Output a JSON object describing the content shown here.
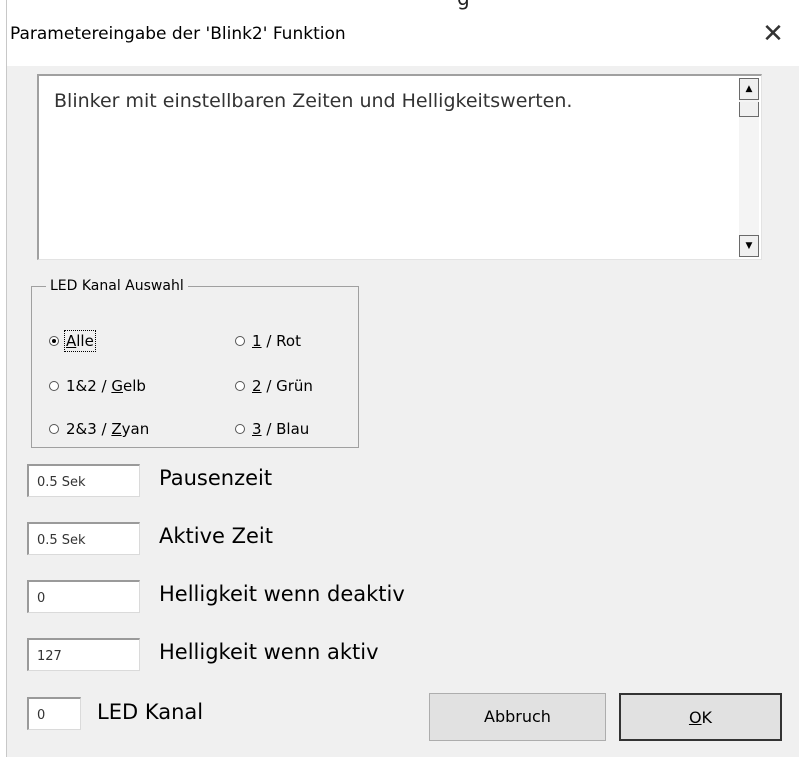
{
  "window": {
    "clipped_top_text": "g",
    "title": "Parametereingabe der 'Blink2' Funktion",
    "close_glyph": "✕"
  },
  "description": {
    "text": "Blinker mit einstellbaren Zeiten und Helligkeitswerten.",
    "scroll_up": "▲",
    "scroll_down": "▼"
  },
  "channel_group": {
    "legend": "LED Kanal Auswahl",
    "options": [
      {
        "pre": "",
        "accel": "A",
        "post": "lle",
        "selected": true
      },
      {
        "pre": "",
        "accel": "1",
        "post": " / Rot",
        "selected": false
      },
      {
        "pre": "1&2 / ",
        "accel": "G",
        "post": "elb",
        "selected": false
      },
      {
        "pre": "",
        "accel": "2",
        "post": " / Grün",
        "selected": false
      },
      {
        "pre": "2&3 / ",
        "accel": "Z",
        "post": "yan",
        "selected": false
      },
      {
        "pre": "",
        "accel": "3",
        "post": " / Blau",
        "selected": false
      }
    ]
  },
  "fields": {
    "pause": {
      "value": "0.5 Sek",
      "label": "Pausenzeit"
    },
    "active": {
      "value": "0.5 Sek",
      "label": "Aktive Zeit"
    },
    "bright_off": {
      "value": "0",
      "label": "Helligkeit wenn deaktiv"
    },
    "bright_on": {
      "value": "127",
      "label": "Helligkeit wenn aktiv"
    },
    "channel": {
      "value": "0",
      "label": "LED Kanal"
    }
  },
  "buttons": {
    "cancel": "Abbruch",
    "ok_accel": "O",
    "ok_rest": "K"
  }
}
